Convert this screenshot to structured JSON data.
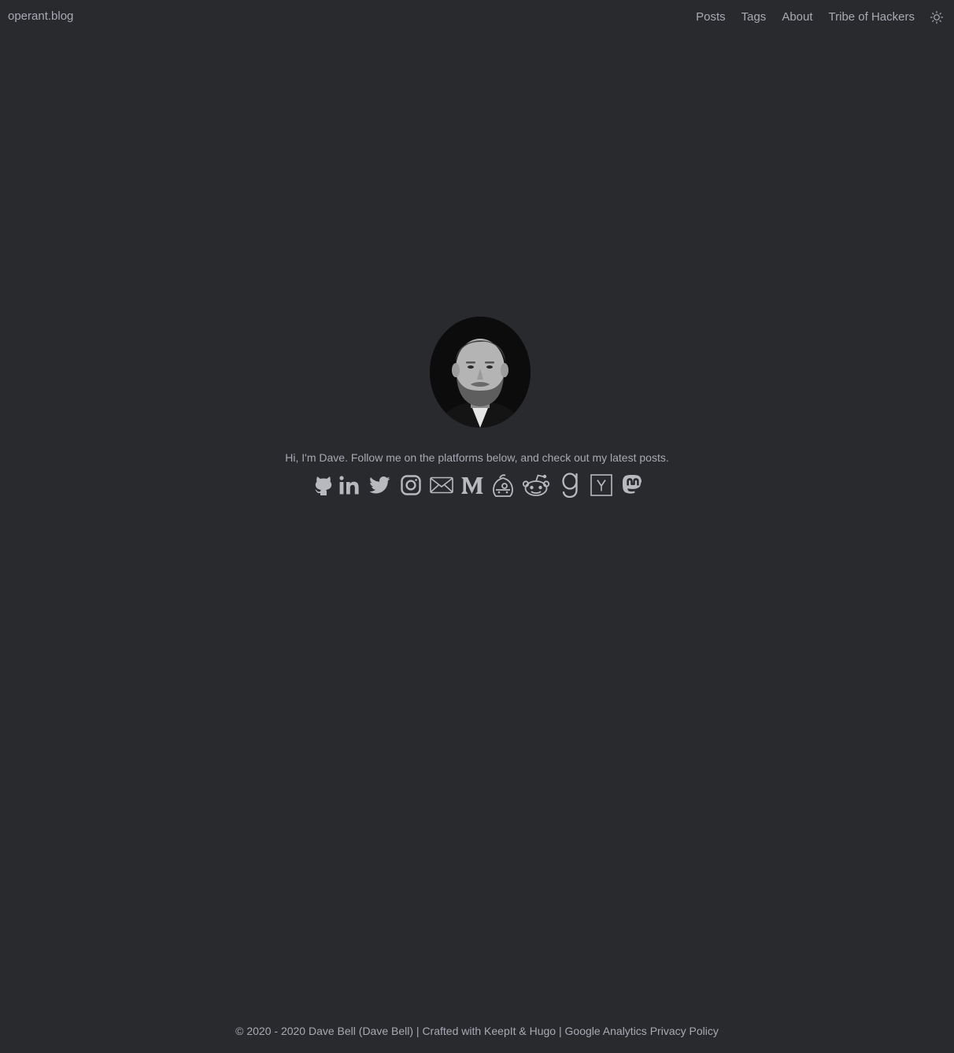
{
  "header": {
    "logo": "operant.blog",
    "nav": [
      "Posts",
      "Tags",
      "About",
      "Tribe of Hackers"
    ],
    "theme_toggle_icon": "sun-icon"
  },
  "intro": {
    "avatar_icon": "profile-photo",
    "text": "Hi, I'm Dave. Follow me on the platforms below, and check out my latest posts."
  },
  "social_icons": [
    "github-icon",
    "linkedin-icon",
    "twitter-icon",
    "instagram-icon",
    "email-icon",
    "medium-icon",
    "keybase-icon",
    "reddit-icon",
    "goodreads-icon",
    "hacker-news-icon",
    "mastodon-icon"
  ],
  "footer": {
    "copyright": "© 2020 - 2020 Dave Bell (Dave Bell) | Crafted with KeepIt & Hugo |",
    "analytics": "Google Analytics",
    "privacy": "Privacy Policy"
  },
  "colors": {
    "background": "#292a2e",
    "text": "#a9a9b3",
    "icon": "#b8b8bf"
  }
}
